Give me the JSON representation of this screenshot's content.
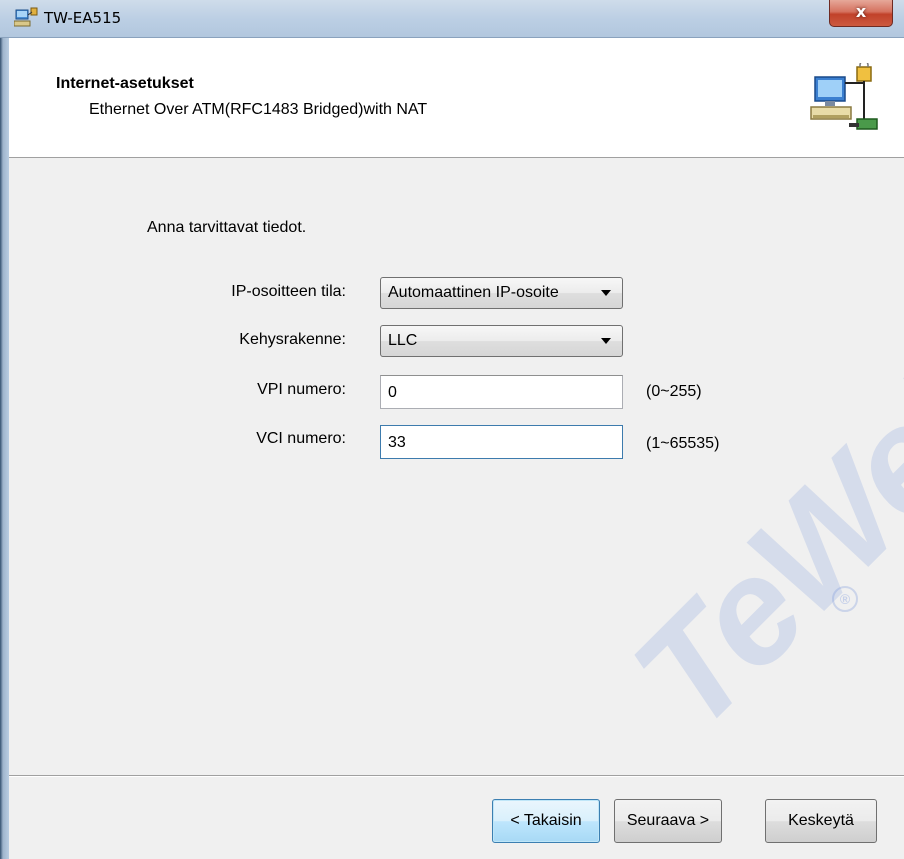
{
  "window": {
    "title": "TW-EA515",
    "close_label": "x"
  },
  "header": {
    "title": "Internet-asetukset",
    "subtitle": "Ethernet Over ATM(RFC1483 Bridged)with NAT",
    "icon": "network-wizard-icon"
  },
  "form": {
    "instruction": "Anna tarvittavat tiedot.",
    "ip_mode": {
      "label": "IP-osoitteen tila:",
      "value": "Automaattinen IP-osoite"
    },
    "frame": {
      "label": "Kehysrakenne:",
      "value": "LLC"
    },
    "vpi": {
      "label": "VPI numero:",
      "value": "0",
      "range": "(0~255)"
    },
    "vci": {
      "label": "VCI numero:",
      "value": "33",
      "range": "(1~65535)"
    }
  },
  "buttons": {
    "back": "< Takaisin",
    "next": "Seuraava >",
    "cancel": "Keskeytä"
  },
  "watermark": {
    "text": "TeWell",
    "mark": "®"
  },
  "colors": {
    "titlebar": "#bccfe4",
    "close_button": "#c1412a",
    "default_button_border": "#3c7fb1",
    "focus_border": "#3d7bad"
  }
}
